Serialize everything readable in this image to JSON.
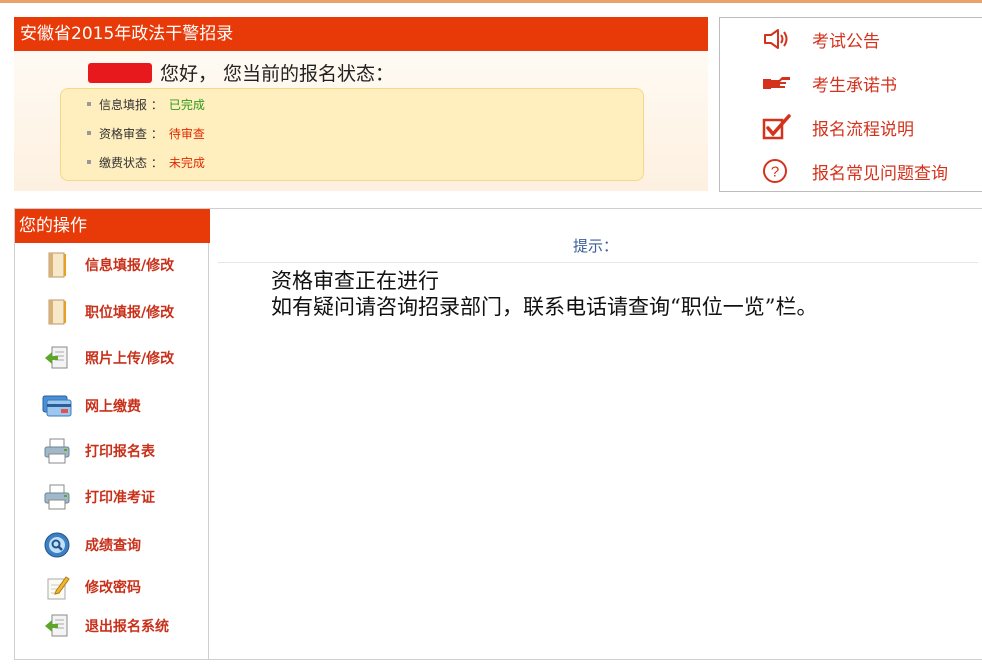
{
  "header": {
    "title": "安徽省2015年政法干警招录",
    "greeting": "您好， 您当前的报名状态："
  },
  "status_items": [
    {
      "label": "信息填报 ：",
      "value": "已完成",
      "color": "#2e9a1c"
    },
    {
      "label": "资格审查 ：",
      "value": "待审查",
      "color": "#e02a00"
    },
    {
      "label": "缴费状态 ：",
      "value": "未完成",
      "color": "#e02a00"
    }
  ],
  "links": [
    {
      "label": "考试公告",
      "icon": "speaker-icon"
    },
    {
      "label": "考生承诺书",
      "icon": "pointing-hand-icon"
    },
    {
      "label": "报名流程说明",
      "icon": "checkbox-icon"
    },
    {
      "label": "报名常见问题查询",
      "icon": "question-icon"
    }
  ],
  "sidebar": {
    "title": "您的操作",
    "items": [
      {
        "label": "信息填报/修改",
        "icon": "notebook-icon"
      },
      {
        "label": "职位填报/修改",
        "icon": "notebook-icon"
      },
      {
        "label": "照片上传/修改",
        "icon": "upload-icon"
      },
      {
        "label": "网上缴费",
        "icon": "credit-card-icon"
      },
      {
        "label": "打印报名表",
        "icon": "printer-icon"
      },
      {
        "label": "打印准考证",
        "icon": "printer-icon"
      },
      {
        "label": "成绩查询",
        "icon": "magnifier-icon"
      },
      {
        "label": "修改密码",
        "icon": "pencil-icon"
      },
      {
        "label": "退出报名系统",
        "icon": "exit-icon"
      }
    ]
  },
  "main": {
    "hint_title": "提示：",
    "message_line1": "资格审查正在进行",
    "message_line2": "如有疑问请咨询招录部门，联系电话请查询“职位一览”栏。"
  },
  "colors": {
    "header_red": "#e83a08",
    "link_red": "#d4321c",
    "status_box": "#ffeebe"
  }
}
